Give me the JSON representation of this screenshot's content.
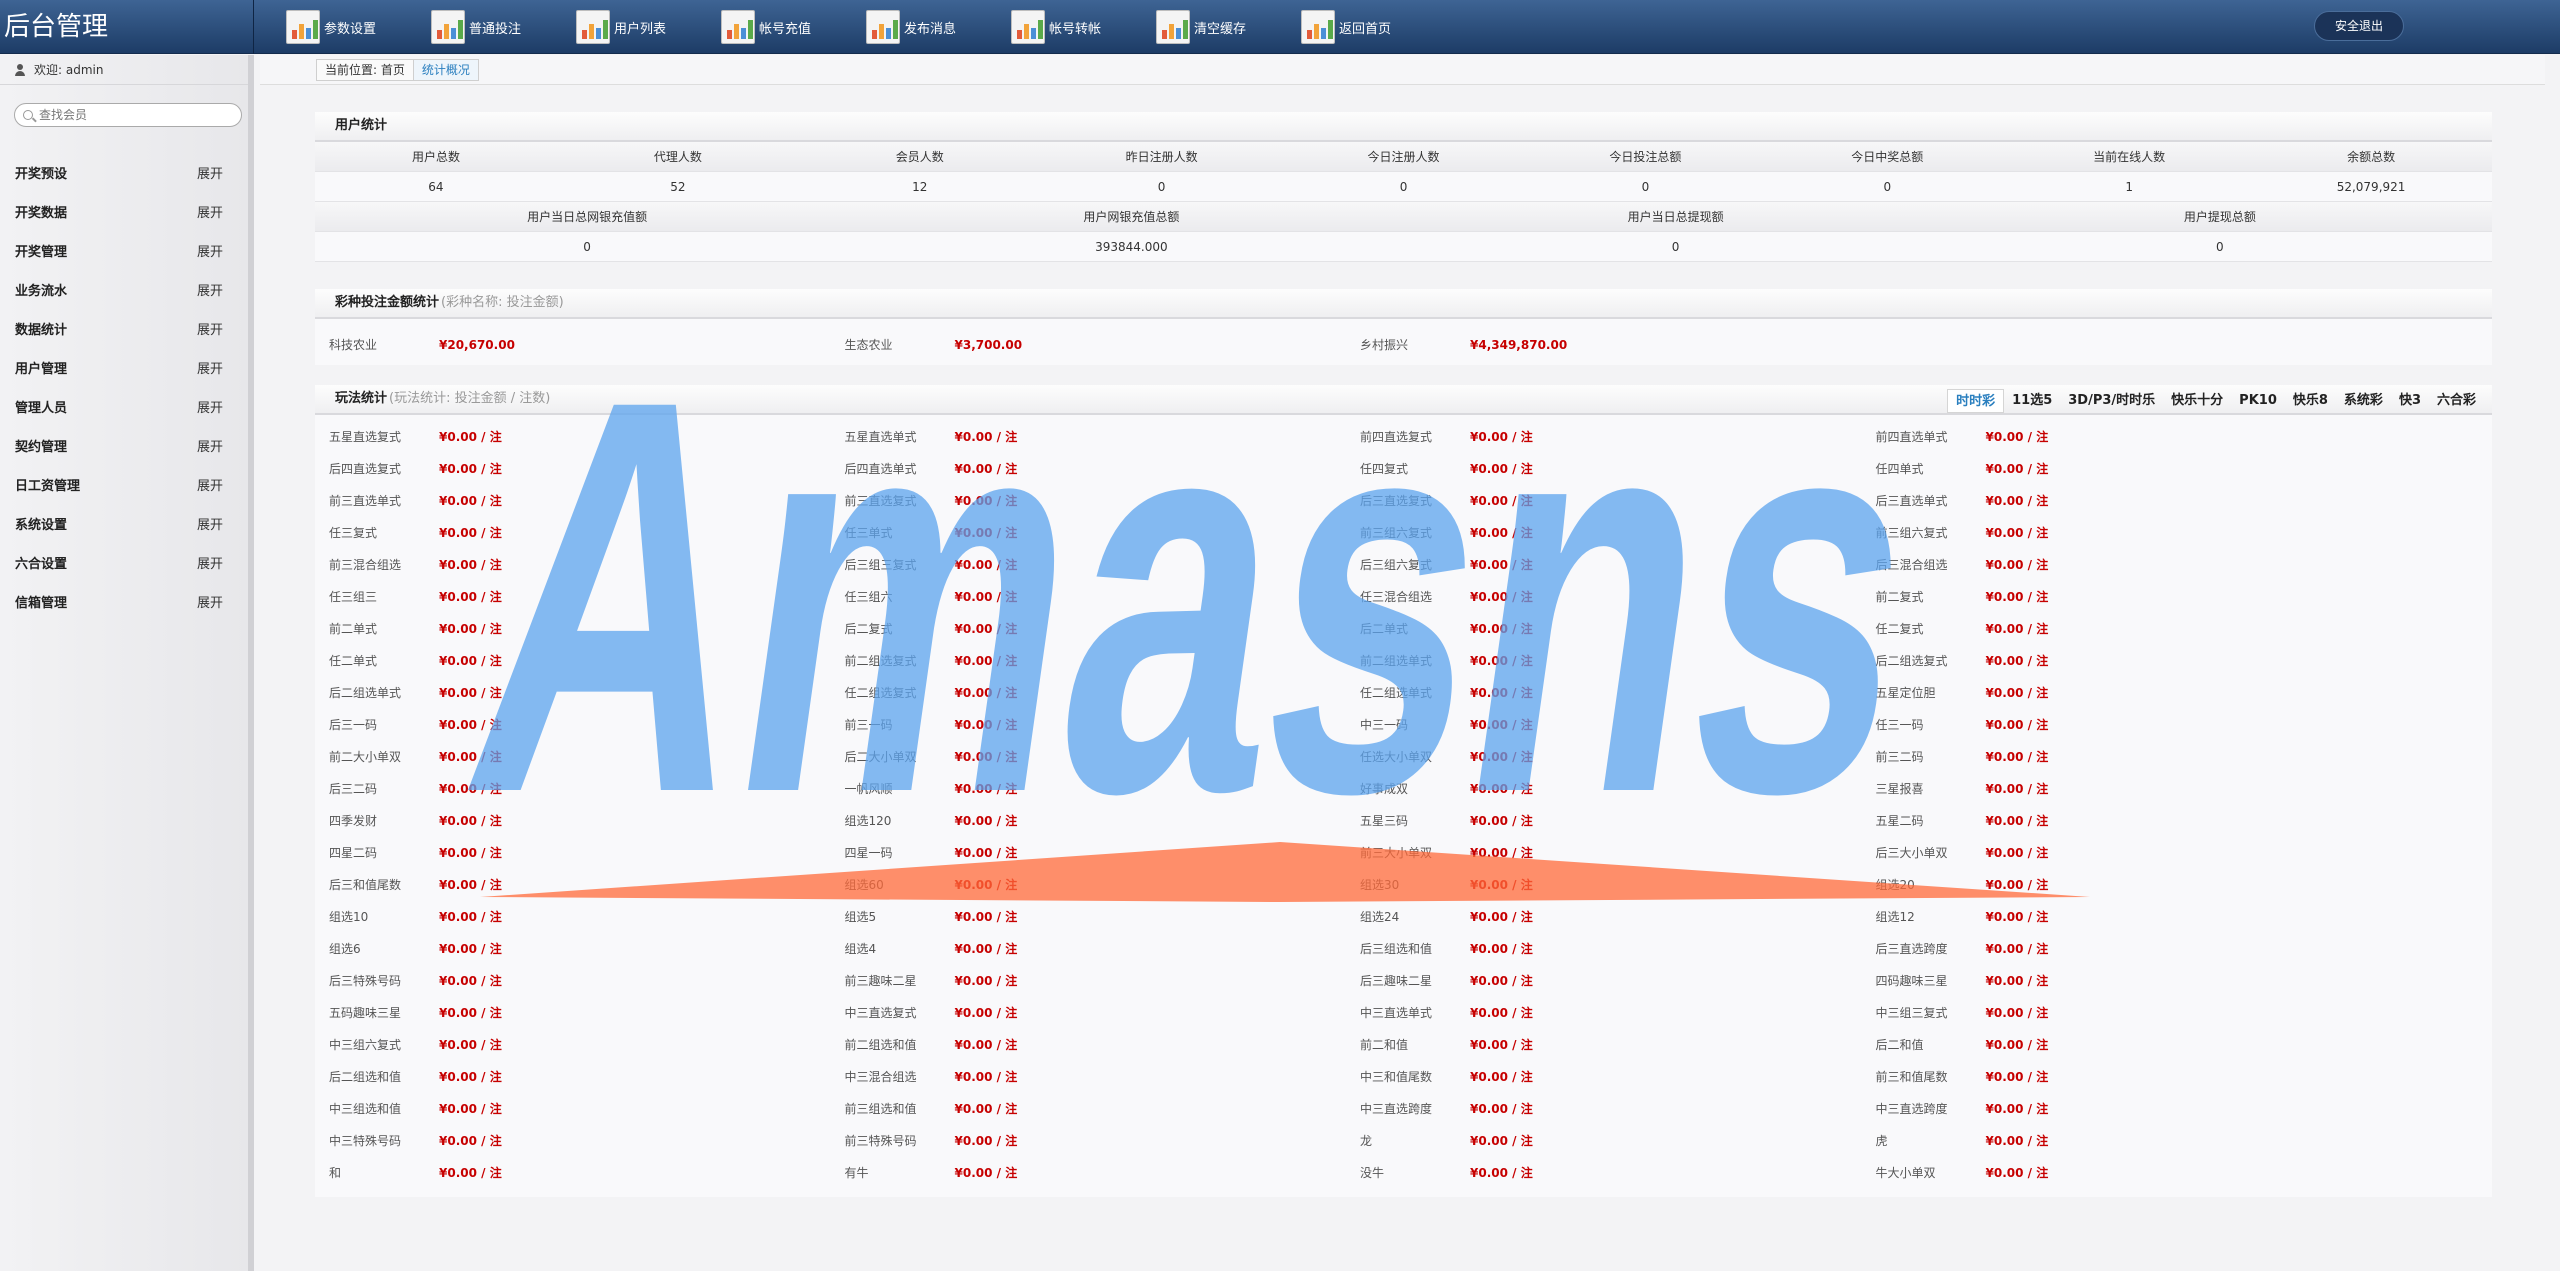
{
  "brand": "后台管理",
  "nav": [
    {
      "label": "参数设置"
    },
    {
      "label": "普通投注"
    },
    {
      "label": "用户列表"
    },
    {
      "label": "帐号充值"
    },
    {
      "label": "发布消息"
    },
    {
      "label": "帐号转帐"
    },
    {
      "label": "清空缓存"
    },
    {
      "label": "返回首页"
    }
  ],
  "logout": "安全退出",
  "sidebar": {
    "welcome": "欢迎: admin",
    "search_placeholder": "查找会员",
    "expand": "展开",
    "items": [
      {
        "label": "开奖预设"
      },
      {
        "label": "开奖数据"
      },
      {
        "label": "开奖管理"
      },
      {
        "label": "业务流水"
      },
      {
        "label": "数据统计"
      },
      {
        "label": "用户管理"
      },
      {
        "label": "管理人员"
      },
      {
        "label": "契约管理"
      },
      {
        "label": "日工资管理"
      },
      {
        "label": "系统设置"
      },
      {
        "label": "六合设置"
      },
      {
        "label": "信箱管理"
      }
    ]
  },
  "breadcrumb": {
    "prefix": "当前位置: 首页",
    "current": "统计概况"
  },
  "user_stats": {
    "title": "用户统计",
    "headers1": [
      "用户总数",
      "代理人数",
      "会员人数",
      "昨日注册人数",
      "今日注册人数",
      "今日投注总额",
      "今日中奖总额",
      "当前在线人数",
      "余额总数"
    ],
    "values1": [
      "64",
      "52",
      "12",
      "0",
      "0",
      "0",
      "0",
      "1",
      "52,079,921"
    ],
    "headers2": [
      "用户当日总网银充值额",
      "用户网银充值总额",
      "用户当日总提现额",
      "用户提现总额"
    ],
    "values2": [
      "0",
      "393844.000",
      "0",
      "0"
    ]
  },
  "lottery_stats": {
    "title": "彩种投注金额统计",
    "subtitle": "(彩种名称: 投注金额)",
    "items": [
      {
        "name": "科技农业",
        "value": "¥20,670.00"
      },
      {
        "name": "生态农业",
        "value": "¥3,700.00"
      },
      {
        "name": "乡村振兴",
        "value": "¥4,349,870.00"
      }
    ]
  },
  "play_stats": {
    "title": "玩法统计",
    "subtitle": "(玩法统计: 投注金额 / 注数)",
    "tabs": [
      "时时彩",
      "11选5",
      "3D/P3/时时乐",
      "快乐十分",
      "PK10",
      "快乐8",
      "系统彩",
      "快3",
      "六合彩"
    ],
    "value": "¥0.00 / 注",
    "names": [
      "五星直选复式",
      "五星直选单式",
      "前四直选复式",
      "前四直选单式",
      "后四直选复式",
      "后四直选单式",
      "任四复式",
      "任四单式",
      "前三直选单式",
      "前三直选复式",
      "后三直选复式",
      "后三直选单式",
      "任三复式",
      "任三单式",
      "前三组六复式",
      "前三组六复式",
      "前三混合组选",
      "后三组三复式",
      "后三组六复式",
      "后三混合组选",
      "任三组三",
      "任三组六",
      "任三混合组选",
      "前二复式",
      "前二单式",
      "后二复式",
      "后二单式",
      "任二复式",
      "任二单式",
      "前二组选复式",
      "前二组选单式",
      "后二组选复式",
      "后二组选单式",
      "任二组选复式",
      "任二组选单式",
      "五星定位胆",
      "后三一码",
      "前三一码",
      "中三一码",
      "任三一码",
      "前二大小单双",
      "后二大小单双",
      "任选大小单双",
      "前三二码",
      "后三二码",
      "一帆风顺",
      "好事成双",
      "三星报喜",
      "四季发财",
      "组选120",
      "五星三码",
      "五星二码",
      "四星二码",
      "四星一码",
      "前三大小单双",
      "后三大小单双",
      "后三和值尾数",
      "组选60",
      "组选30",
      "组选20",
      "组选10",
      "组选5",
      "组选24",
      "组选12",
      "组选6",
      "组选4",
      "后三组选和值",
      "后三直选跨度",
      "后三特殊号码",
      "前三趣味二星",
      "后三趣味二星",
      "四码趣味三星",
      "五码趣味三星",
      "中三直选复式",
      "中三直选单式",
      "中三组三复式",
      "中三组六复式",
      "前二组选和值",
      "前二和值",
      "后二和值",
      "后二组选和值",
      "中三混合组选",
      "中三和值尾数",
      "前三和值尾数",
      "中三组选和值",
      "前三组选和值",
      "中三直选跨度",
      "中三直选跨度",
      "中三特殊号码",
      "前三特殊号码",
      "龙",
      "虎",
      "和",
      "有牛",
      "没牛",
      "牛大小单双"
    ]
  },
  "watermark": "Amasns"
}
